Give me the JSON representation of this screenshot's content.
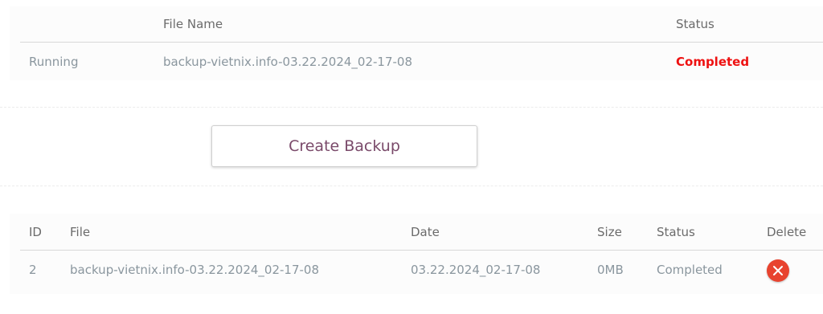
{
  "running_table": {
    "headers": [
      "",
      "File Name",
      "Status"
    ],
    "row": {
      "label": "Running",
      "file_name": "backup-vietnix.info-03.22.2024_02-17-08",
      "status": "Completed"
    },
    "status_color": "#ee1111"
  },
  "actions": {
    "create_backup_label": "Create Backup"
  },
  "backups_table": {
    "headers": [
      "ID",
      "File",
      "Date",
      "Size",
      "Status",
      "Delete"
    ],
    "rows": [
      {
        "id": "2",
        "file": "backup-vietnix.info-03.22.2024_02-17-08",
        "date": "03.22.2024_02-17-08",
        "size": "0MB",
        "status": "Completed",
        "delete_icon": "close-circle-icon"
      }
    ],
    "delete_color": "#e8432f"
  }
}
